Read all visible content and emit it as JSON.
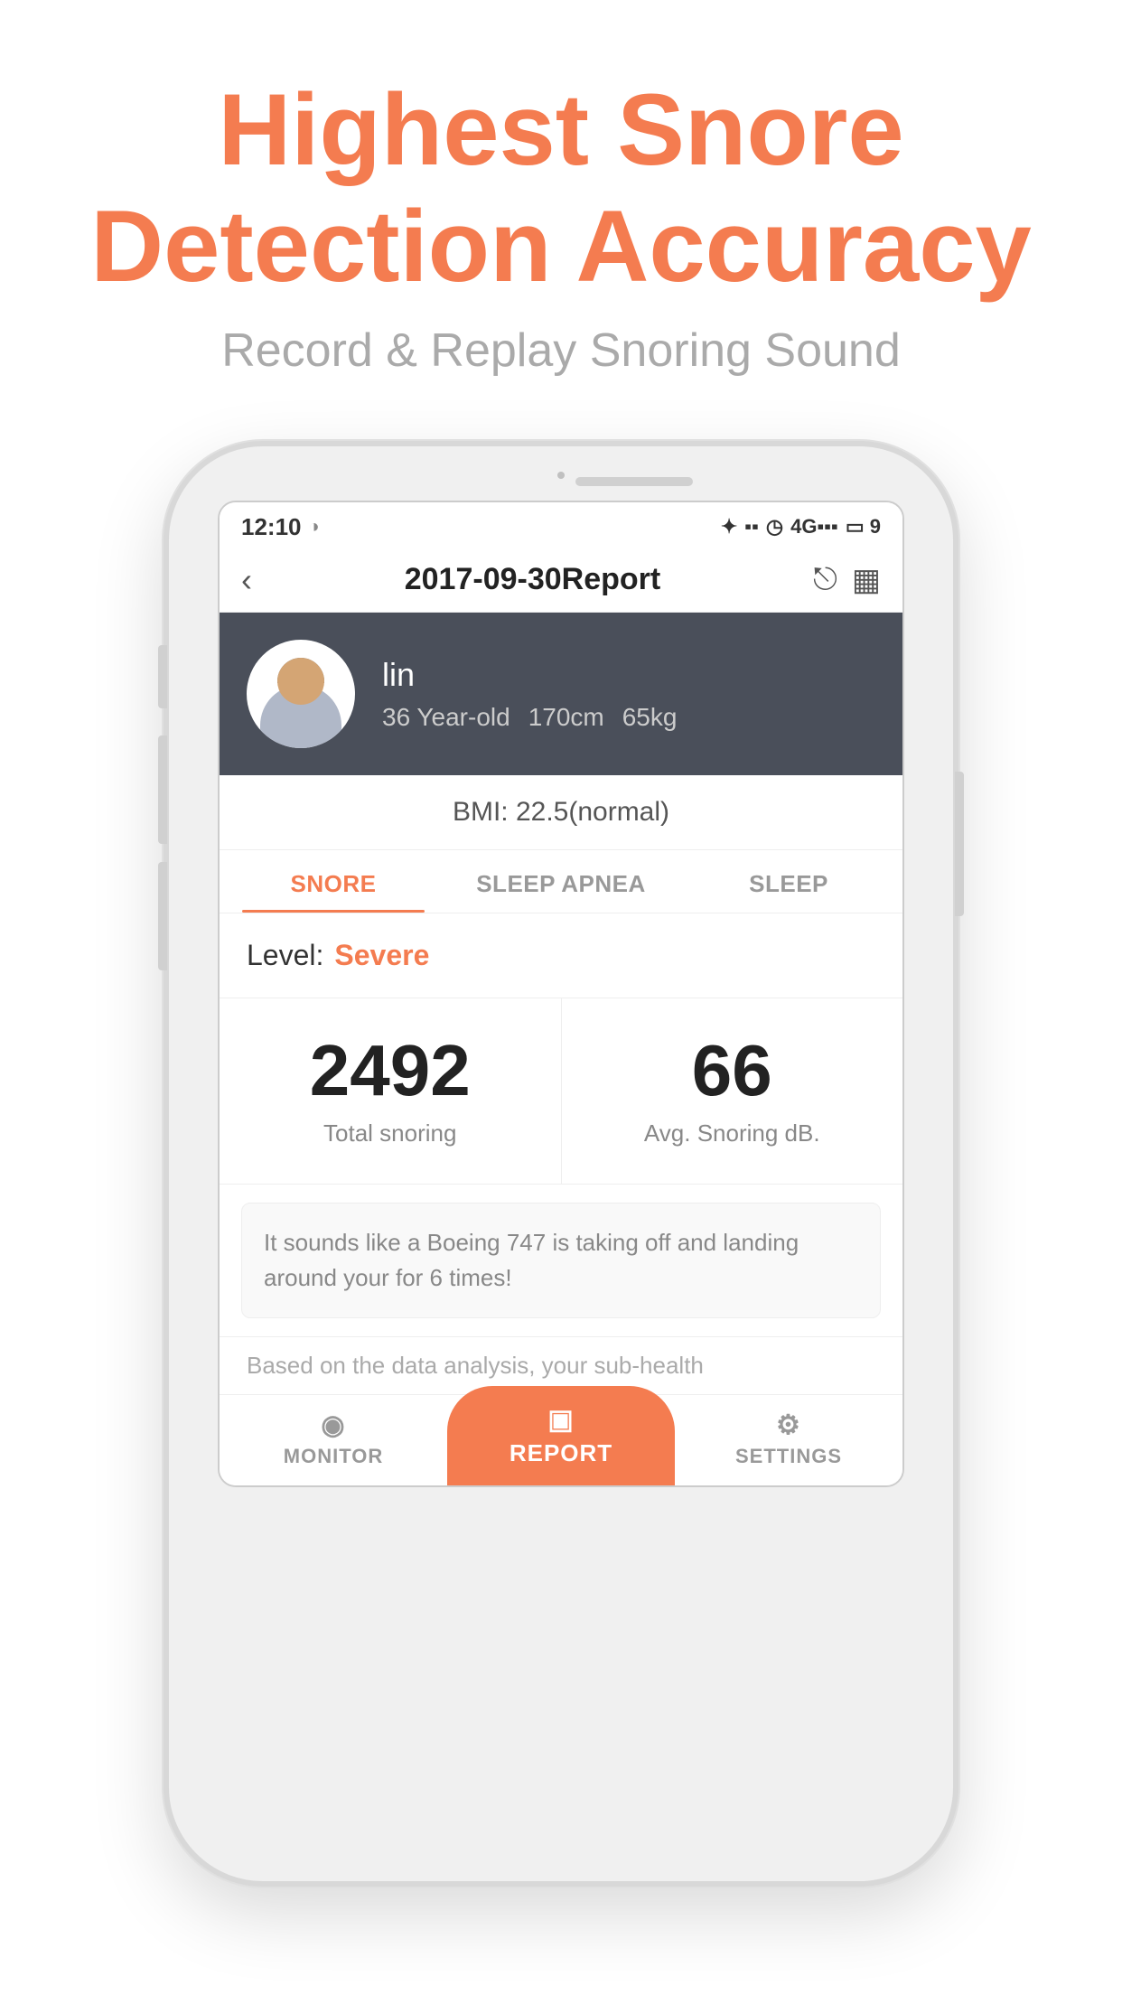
{
  "page": {
    "title_line1": "Highest Snore",
    "title_line2": "Detection Accuracy",
    "subtitle": "Record & Replay Snoring Sound"
  },
  "status_bar": {
    "time": "12:10",
    "bluetooth": "✦",
    "vibrate": "▪",
    "alarm": "◷",
    "signal": "4G",
    "battery": "9"
  },
  "nav": {
    "title": "2017-09-30Report",
    "back_label": "‹",
    "share_icon": "⎋",
    "calendar_icon": "📅"
  },
  "profile": {
    "name": "lin",
    "age": "36 Year-old",
    "height": "170cm",
    "weight": "65kg"
  },
  "bmi": {
    "label": "BMI: 22.5(normal)"
  },
  "tabs": [
    {
      "label": "SNORE",
      "active": true
    },
    {
      "label": "SLEEP APNEA",
      "active": false
    },
    {
      "label": "SLEEP",
      "active": false
    }
  ],
  "snore": {
    "level_label": "Level:",
    "level_value": "Severe",
    "total_snoring_value": "2492",
    "total_snoring_label": "Total snoring",
    "avg_db_value": "66",
    "avg_db_label": "Avg. Snoring dB.",
    "description": "It sounds like a Boeing 747 is taking off and landing around your for 6 times!",
    "analysis_text": "Based on the data analysis, your sub-health"
  },
  "bottom_nav": [
    {
      "label": "MONITOR",
      "icon": "◉"
    },
    {
      "label": "REPORT",
      "icon": "▣",
      "active": true
    },
    {
      "label": "SETTINGS",
      "icon": "⚙"
    }
  ]
}
